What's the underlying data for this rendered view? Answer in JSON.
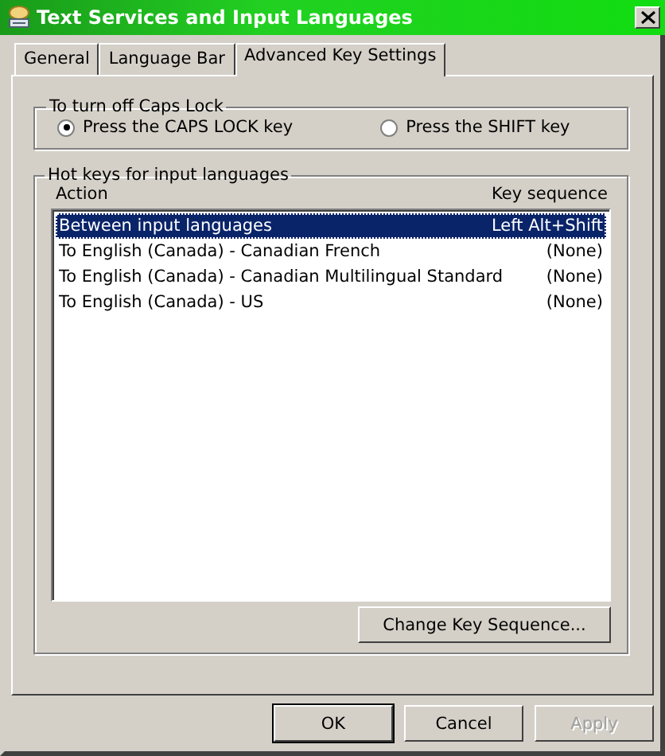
{
  "window": {
    "title": "Text Services and Input Languages"
  },
  "tabs": [
    {
      "label": "General",
      "selected": false
    },
    {
      "label": "Language Bar",
      "selected": false
    },
    {
      "label": "Advanced Key Settings",
      "selected": true
    }
  ],
  "caps_lock": {
    "title": "To turn off Caps Lock",
    "options": [
      {
        "label": "Press the CAPS LOCK key",
        "selected": true
      },
      {
        "label": "Press the SHIFT key",
        "selected": false
      }
    ]
  },
  "hot_keys": {
    "title": "Hot keys for input languages",
    "columns": [
      "Action",
      "Key sequence"
    ],
    "rows": [
      {
        "action": "Between input languages",
        "key_sequence": "Left Alt+Shift",
        "selected": true
      },
      {
        "action": "To English (Canada) - Canadian French",
        "key_sequence": "(None)",
        "selected": false
      },
      {
        "action": "To English (Canada) - Canadian Multilingual Standard",
        "key_sequence": "(None)",
        "selected": false
      },
      {
        "action": "To English (Canada) - US",
        "key_sequence": "(None)",
        "selected": false
      }
    ],
    "change_button": "Change Key Sequence..."
  },
  "buttons": [
    {
      "label": "OK",
      "default": true,
      "disabled": false
    },
    {
      "label": "Cancel",
      "default": false,
      "disabled": false
    },
    {
      "label": "Apply",
      "default": false,
      "disabled": true
    }
  ]
}
